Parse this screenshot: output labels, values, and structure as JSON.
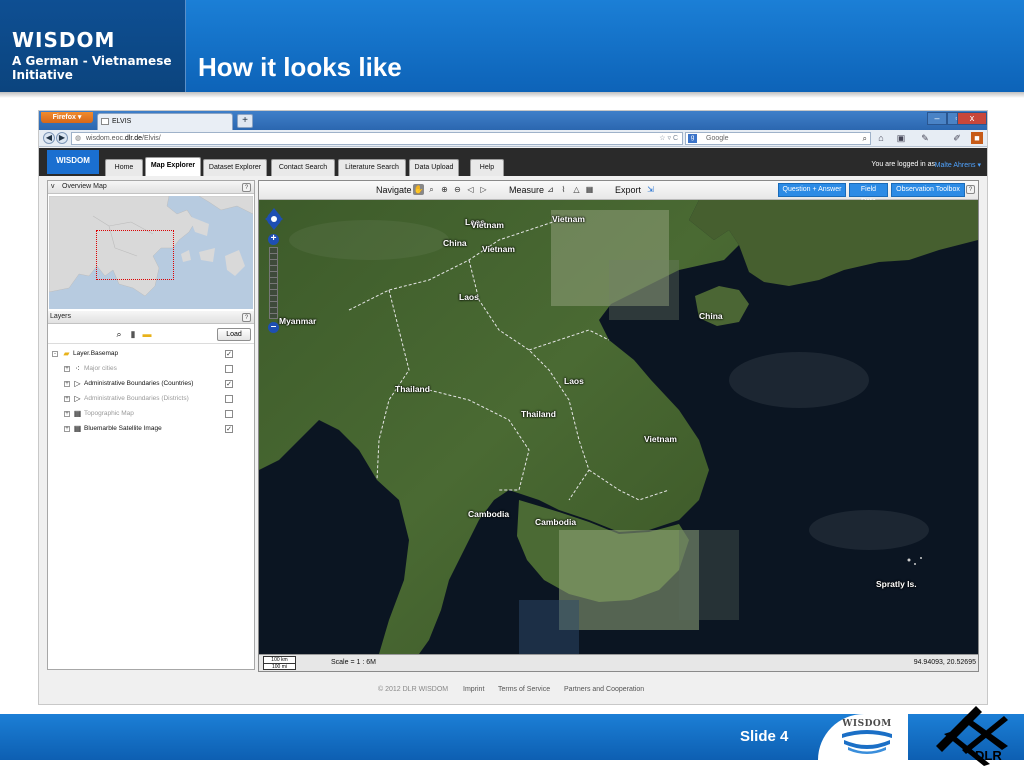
{
  "slide": {
    "brand_title": "WISDOM",
    "brand_subtitle": "A German - Vietnamese Initiative",
    "title": "How it looks like",
    "slide_number": "Slide 4",
    "footer_logo_text": "WISDOM",
    "dlr_text": "DLR"
  },
  "browser": {
    "menu_button": "Firefox",
    "tab_title": "ELVIS",
    "new_tab": "+",
    "url_prefix": "wisdom.eoc.",
    "url_domain": "dlr.de",
    "url_path": "/Elvis/",
    "search_placeholder": "Google",
    "search_engine_icon": "google-icon",
    "win_minimize": "–",
    "win_maximize": "▫",
    "win_close": "x"
  },
  "app": {
    "logo": "WISDOM",
    "tabs": [
      {
        "label": "Home"
      },
      {
        "label": "Map Explorer"
      },
      {
        "label": "Dataset Explorer"
      },
      {
        "label": "Contact Search"
      },
      {
        "label": "Literature Search"
      },
      {
        "label": "Data Upload"
      },
      {
        "label": "Help"
      }
    ],
    "active_tab": "Map Explorer",
    "logged_in_text": "You are logged in as",
    "user_name": "Malte Ahrens"
  },
  "left_panel": {
    "overview_title": "Overview Map",
    "layers_title": "Layers",
    "help": "?",
    "load_button": "Load",
    "layers": [
      {
        "label": "Layer.Basemap",
        "checked": true,
        "enabled": true
      },
      {
        "label": "Major cities",
        "checked": false,
        "enabled": false
      },
      {
        "label": "Administrative Boundaries (Countries)",
        "checked": true,
        "enabled": true
      },
      {
        "label": "Administrative Boundaries (Districts)",
        "checked": false,
        "enabled": false
      },
      {
        "label": "Topographic Map",
        "checked": false,
        "enabled": false
      },
      {
        "label": "Bluemarble Satellite Image",
        "checked": true,
        "enabled": true
      }
    ]
  },
  "map": {
    "toolbar": {
      "navigate": "Navigate",
      "measure": "Measure",
      "export": "Export",
      "buttons": [
        "Question + Answer",
        "Field Data",
        "Observation Toolbox"
      ]
    },
    "labels": [
      "Vietnam",
      "Laos",
      "Vietnam",
      "China",
      "Vietnam",
      "Laos",
      "China",
      "Myanmar",
      "Laos",
      "Thailand",
      "Thailand",
      "Vietnam",
      "Cambodia",
      "Cambodia",
      "Spratly Is."
    ],
    "scale_top": "100 km",
    "scale_bottom": "100 mi",
    "scale_text": "Scale = 1 : 6M",
    "coordinates": "94.94093, 20.52695"
  },
  "web_footer": {
    "copyright": "© 2012 DLR WISDOM",
    "links": [
      "Imprint",
      "Terms of Service",
      "Partners and Cooperation"
    ]
  },
  "colors": {
    "slide_blue": "#1b7fd6",
    "app_accent": "#2c8be5",
    "header_dark": "#2a2a2a"
  }
}
